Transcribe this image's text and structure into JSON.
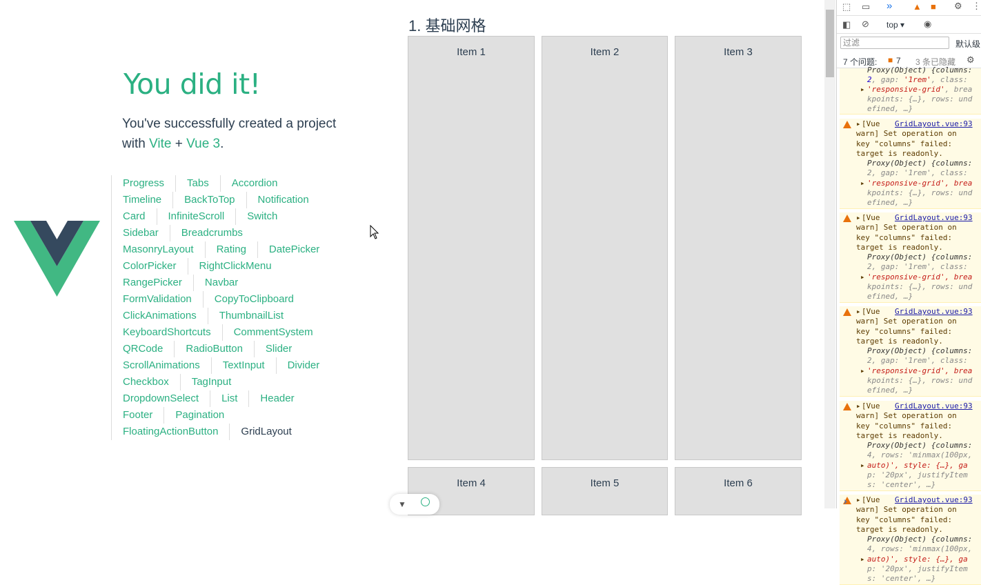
{
  "hero": {
    "title": "You did it!",
    "subtitle_prefix": "You've successfully created a project with",
    "vite": "Vite",
    "plus": "+",
    "vue": "Vue 3",
    "suffix": "."
  },
  "nav": {
    "links": [
      "Progress",
      "Tabs",
      "Accordion",
      "Timeline",
      "BackToTop",
      "Notification",
      "Card",
      "InfiniteScroll",
      "Switch",
      "Sidebar",
      "Breadcrumbs",
      "MasonryLayout",
      "Rating",
      "DatePicker",
      "ColorPicker",
      "RightClickMenu",
      "RangePicker",
      "Navbar",
      "FormValidation",
      "CopyToClipboard",
      "ClickAnimations",
      "ThumbnailList",
      "KeyboardShortcuts",
      "CommentSystem",
      "QRCode",
      "RadioButton",
      "Slider",
      "ScrollAnimations",
      "TextInput",
      "Divider",
      "Checkbox",
      "TagInput",
      "DropdownSelect",
      "List",
      "Header",
      "Footer",
      "Pagination",
      "FloatingActionButton",
      "GridLayout"
    ],
    "active": "GridLayout"
  },
  "grid_demo": {
    "title": "1. 基础网格",
    "items": [
      "Item 1",
      "Item 2",
      "Item 3",
      "Item 4",
      "Item 5",
      "Item 6"
    ]
  },
  "colors": {
    "vue_green": "#2bb082",
    "vue_dark": "#2c3e50",
    "warn_bg": "#fffbe5"
  },
  "devtools": {
    "context": "top",
    "filter_placeholder": "过滤",
    "levels": "默认级",
    "issues_label": "7 个问题:",
    "issues_count": "7",
    "hidden_label": "3 条已隐藏",
    "top_fragment": {
      "line1": "Proxy(Object) {columns:",
      "line2a": "2",
      "line2b": ", gap: ",
      "line2c": "'1rem'",
      "line2d": ", class:",
      "line3": "'responsive-grid'",
      "line3b": ", brea",
      "line4": "kpoints: {…}, rows: und",
      "line5": "efined, …}"
    },
    "warnings": [
      {
        "source": "GridLayout.vue:93",
        "l1": "[Vue",
        "l2": "warn] Set operation on",
        "l3": "key \"columns\" failed:",
        "l4": "target is readonly.",
        "proxy": "Proxy(Object) {columns:",
        "p2": "2, gap: '1rem', class:",
        "p3": "'responsive-grid', brea",
        "p4": "kpoints: {…}, rows: und",
        "p5": "efined, …}"
      },
      {
        "source": "GridLayout.vue:93",
        "l1": "[Vue",
        "l2": "warn] Set operation on",
        "l3": "key \"columns\" failed:",
        "l4": "target is readonly.",
        "proxy": "Proxy(Object) {columns:",
        "p2": "2, gap: '1rem', class:",
        "p3": "'responsive-grid', brea",
        "p4": "kpoints: {…}, rows: und",
        "p5": "efined, …}"
      },
      {
        "source": "GridLayout.vue:93",
        "l1": "[Vue",
        "l2": "warn] Set operation on",
        "l3": "key \"columns\" failed:",
        "l4": "target is readonly.",
        "proxy": "Proxy(Object) {columns:",
        "p2": "2, gap: '1rem', class:",
        "p3": "'responsive-grid', brea",
        "p4": "kpoints: {…}, rows: und",
        "p5": "efined, …}"
      },
      {
        "source": "GridLayout.vue:93",
        "l1": "[Vue",
        "l2": "warn] Set operation on",
        "l3": "key \"columns\" failed:",
        "l4": "target is readonly.",
        "proxy": "Proxy(Object) {columns:",
        "p2": "4, rows: 'minmax(100px,",
        "p3": "auto)', style: {…}, ga",
        "p4": "p: '20px', justifyItem",
        "p5": "s: 'center', …}"
      },
      {
        "source": "GridLayout.vue:93",
        "l1": "[Vue",
        "l2": "warn] Set operation on",
        "l3": "key \"columns\" failed:",
        "l4": "target is readonly.",
        "proxy": "Proxy(Object) {columns:",
        "p2": "4, rows: 'minmax(100px,",
        "p3": "auto)', style: {…}, ga",
        "p4": "p: '20px', justifyItem",
        "p5": "s: 'center', …}"
      }
    ],
    "prompt": "›"
  }
}
